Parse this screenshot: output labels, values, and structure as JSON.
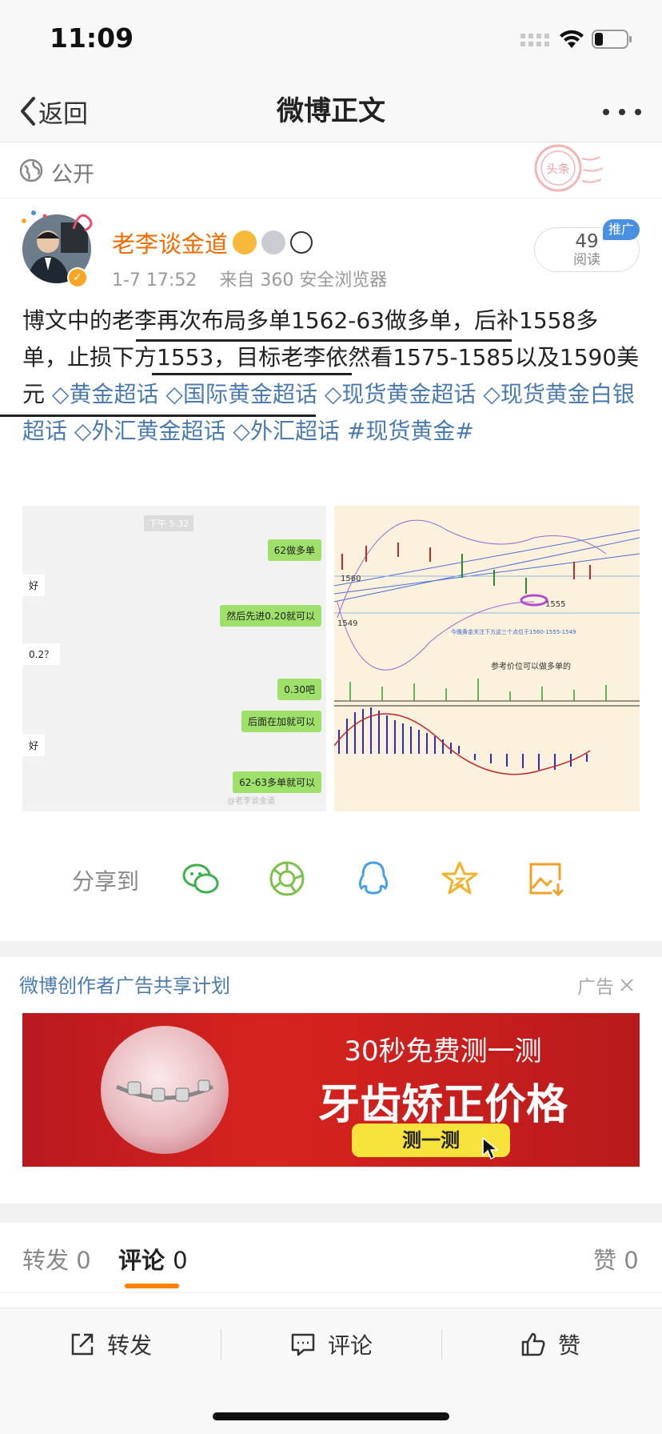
{
  "status_bar": {
    "time": "11:09"
  },
  "nav": {
    "back_label": "返回",
    "title": "微博正文"
  },
  "visibility": {
    "label": "公开"
  },
  "author": {
    "name": "老李谈金道",
    "time": "1-7 17:52",
    "source": "来自 360 安全浏览器",
    "reads_count": "49",
    "reads_label": "阅读",
    "promo_badge": "推广"
  },
  "post": {
    "segments": [
      {
        "text": "博文中的",
        "type": "text"
      },
      {
        "text": "老李再次布局多单1562-63做多单",
        "type": "text"
      },
      {
        "text": "，后补1558多单，止损下方1553，目标老李依然看",
        "type": "text"
      },
      {
        "text": "1575-1585以及1590美元",
        "type": "text"
      }
    ],
    "topics": [
      "黄金超话",
      "国际黄金超话",
      "现货黄金超话",
      "现货黄金白银超话",
      "外汇黄金超话",
      "外汇超话"
    ],
    "hashtag": "#现货黄金#"
  },
  "images": {
    "chat": {
      "timestamp": "下午 5:32",
      "bubbles_right": [
        "62做多单",
        "然后先进0.20就可以",
        "0.30吧",
        "后面在加就可以",
        "62-63多单就可以"
      ],
      "bubbles_left": [
        "好",
        "0.2？",
        "好"
      ],
      "watermark": "@老李谈金道"
    },
    "chart": {
      "labels": [
        "1560",
        "1549",
        "1555"
      ],
      "note": "今晚黄金关注下方这三个点位于1560-1555-1549",
      "caption": "参考价位可以做多单的"
    }
  },
  "share": {
    "label": "分享到",
    "targets": [
      "wechat-icon",
      "moments-icon",
      "qq-icon",
      "favorite-icon",
      "save-image-icon"
    ]
  },
  "ad": {
    "header": "微博创作者广告共享计划",
    "tag": "广告",
    "line1": "30秒免费测一测",
    "line2": "牙齿矫正价格",
    "button": "测一测"
  },
  "tabs": [
    {
      "label": "转发",
      "count": "0"
    },
    {
      "label": "评论",
      "count": "0"
    },
    {
      "label": "赞",
      "count": "0"
    }
  ],
  "bottom_bar": {
    "repost": "转发",
    "comment": "评论",
    "like": "赞"
  },
  "colors": {
    "accent": "#ff8200",
    "link": "#4a7bb0",
    "name": "#f06a00"
  }
}
